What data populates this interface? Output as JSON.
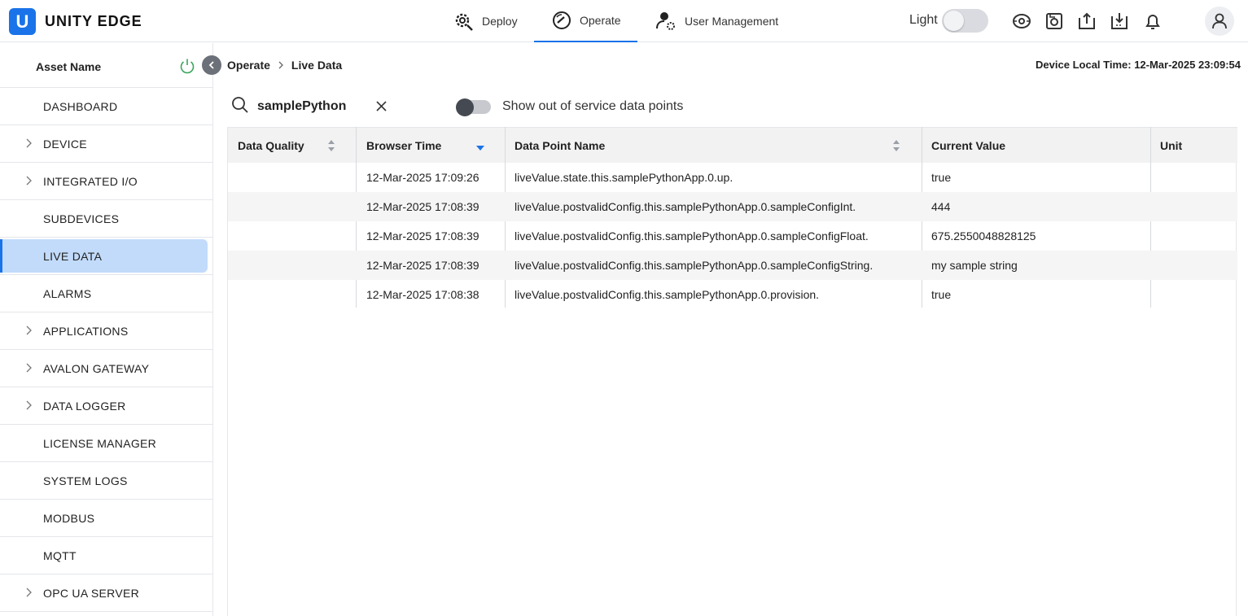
{
  "app": {
    "logo_letter": "U",
    "name": "UNITY EDGE"
  },
  "nav": {
    "deploy": "Deploy",
    "operate": "Operate",
    "users": "User Management",
    "active": "Operate"
  },
  "header": {
    "theme_label": "Light",
    "icons": [
      "disk-icon",
      "save-icon",
      "upload-icon",
      "download-icon",
      "bell-icon",
      "user-avatar-icon"
    ]
  },
  "sidebar": {
    "title": "Asset Name",
    "items": [
      {
        "label": "DASHBOARD",
        "expandable": false
      },
      {
        "label": "DEVICE",
        "expandable": true
      },
      {
        "label": "INTEGRATED I/O",
        "expandable": true
      },
      {
        "label": "SUBDEVICES",
        "expandable": false
      },
      {
        "label": "LIVE DATA",
        "expandable": false,
        "active": true
      },
      {
        "label": "ALARMS",
        "expandable": false
      },
      {
        "label": "APPLICATIONS",
        "expandable": true
      },
      {
        "label": "AVALON GATEWAY",
        "expandable": true
      },
      {
        "label": "DATA LOGGER",
        "expandable": true
      },
      {
        "label": "LICENSE MANAGER",
        "expandable": false
      },
      {
        "label": "SYSTEM LOGS",
        "expandable": false
      },
      {
        "label": "MODBUS",
        "expandable": false
      },
      {
        "label": "MQTT",
        "expandable": false
      },
      {
        "label": "OPC UA SERVER",
        "expandable": true
      }
    ]
  },
  "breadcrumb": {
    "parent": "Operate",
    "current": "Live Data"
  },
  "device_time": "Device Local Time: 12-Mar-2025 23:09:54",
  "filter": {
    "search_value": "samplePython",
    "oos_label": "Show out of service data points",
    "oos_enabled": false
  },
  "table": {
    "columns": [
      "Data Quality",
      "Browser Time",
      "Data Point Name",
      "Current Value",
      "Unit"
    ],
    "sorted_column": "Browser Time",
    "sort_direction": "descending",
    "rows": [
      {
        "quality": "",
        "time": "12-Mar-2025 17:09:26",
        "name": "liveValue.state.this.samplePythonApp.0.up.",
        "value": "true",
        "unit": ""
      },
      {
        "quality": "",
        "time": "12-Mar-2025 17:08:39",
        "name": "liveValue.postvalidConfig.this.samplePythonApp.0.sampleConfigInt.",
        "value": "444",
        "unit": ""
      },
      {
        "quality": "",
        "time": "12-Mar-2025 17:08:39",
        "name": "liveValue.postvalidConfig.this.samplePythonApp.0.sampleConfigFloat.",
        "value": "675.2550048828125",
        "unit": ""
      },
      {
        "quality": "",
        "time": "12-Mar-2025 17:08:39",
        "name": "liveValue.postvalidConfig.this.samplePythonApp.0.sampleConfigString.",
        "value": "my sample string",
        "unit": ""
      },
      {
        "quality": "",
        "time": "12-Mar-2025 17:08:38",
        "name": "liveValue.postvalidConfig.this.samplePythonApp.0.provision.",
        "value": "true",
        "unit": ""
      }
    ]
  },
  "colors": {
    "accent": "#1a73e8",
    "active_bg": "#c2dbfb",
    "power_green": "#3aa55c"
  }
}
